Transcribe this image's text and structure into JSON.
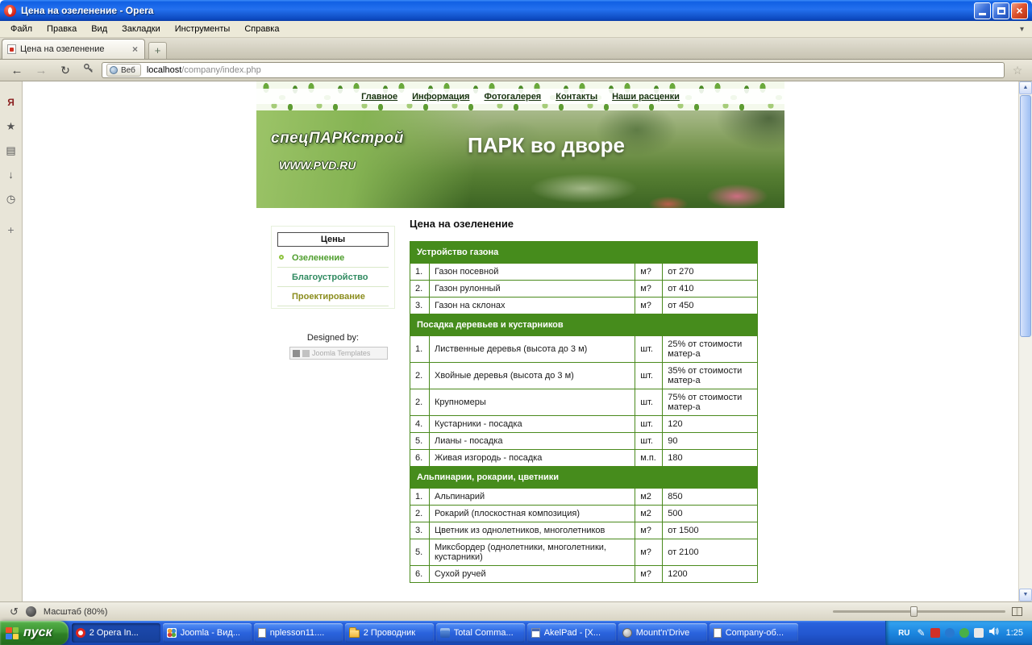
{
  "colors": {
    "accent_green": "#468c1c",
    "xp_blue": "#245edb",
    "start_green": "#3d9434"
  },
  "titlebar": {
    "title": "Цена на озеленение - Opera"
  },
  "menubar": {
    "items": [
      "Файл",
      "Правка",
      "Вид",
      "Закладки",
      "Инструменты",
      "Справка"
    ]
  },
  "tabbar": {
    "active_tab": "Цена на озеленение"
  },
  "addressbar": {
    "badge": "Веб",
    "host": "localhost",
    "path": "/company/index.php"
  },
  "page": {
    "nav_links": [
      "Главное",
      "Информация",
      "Фотогалерея",
      "Контакты",
      "Наши расценки"
    ],
    "banner": {
      "logo_line1": "спецПАРКстрой",
      "logo_line2": "WWW.PVD.RU",
      "slogan": "ПАРК во дворе"
    },
    "menu": {
      "title": "Цены",
      "items": [
        "Озеленение",
        "Благоустройство",
        "Проектирование"
      ]
    },
    "designed_by": "Designed by:",
    "designer_badge": "Joomla Templates",
    "heading": "Цена на озеленение",
    "sections": [
      {
        "header": "Устройство газона",
        "rows": [
          {
            "n": "1.",
            "name": "Газон посевной",
            "unit": "м?",
            "price": "от 270"
          },
          {
            "n": "2.",
            "name": "Газон рулонный",
            "unit": "м?",
            "price": "от 410"
          },
          {
            "n": "3.",
            "name": "Газон на склонах",
            "unit": "м?",
            "price": "от 450"
          }
        ]
      },
      {
        "header": "Посадка деревьев и кустарников",
        "rows": [
          {
            "n": "1.",
            "name": "Лиственные деревья (высота до 3 м)",
            "unit": "шт.",
            "price": "25% от стоимости матер-а"
          },
          {
            "n": "2.",
            "name": "Хвойные деревья (высота до 3 м)",
            "unit": "шт.",
            "price": "35% от стоимости матер-а"
          },
          {
            "n": "2.",
            "name": "Крупномеры",
            "unit": "шт.",
            "price": "75% от стоимости матер-а"
          },
          {
            "n": "4.",
            "name": "Кустарники - посадка",
            "unit": "шт.",
            "price": "120"
          },
          {
            "n": "5.",
            "name": "Лианы - посадка",
            "unit": "шт.",
            "price": "90"
          },
          {
            "n": "6.",
            "name": "Живая изгородь - посадка",
            "unit": "м.п.",
            "price": "180"
          }
        ]
      },
      {
        "header": "Альпинарии, рокарии, цветники",
        "rows": [
          {
            "n": "1.",
            "name": "Альпинарий",
            "unit": "м2",
            "price": "850"
          },
          {
            "n": "2.",
            "name": "Рокарий (плоскостная композиция)",
            "unit": "м2",
            "price": "500"
          },
          {
            "n": "3.",
            "name": "Цветник из однолетников, многолетников",
            "unit": "м?",
            "price": "от 1500"
          },
          {
            "n": "5.",
            "name": "Миксбордер (однолетники, многолетники, кустарники)",
            "unit": "м?",
            "price": "от 2100"
          },
          {
            "n": "6.",
            "name": "Сухой ручей",
            "unit": "м?",
            "price": "1200"
          }
        ]
      }
    ]
  },
  "statusbar": {
    "zoom_label": "Масштаб (80%)"
  },
  "taskbar": {
    "start_label": "пуск",
    "items": [
      {
        "label": "2 Opera In...",
        "icon": "opera"
      },
      {
        "label": "Joomla - Вид...",
        "icon": "joomla"
      },
      {
        "label": "nplesson11....",
        "icon": "document"
      },
      {
        "label": "2 Проводник",
        "icon": "folder"
      },
      {
        "label": "Total Comma...",
        "icon": "total-commander"
      },
      {
        "label": "AkelPad - [X...",
        "icon": "notepad"
      },
      {
        "label": "Mount'n'Drive",
        "icon": "drive"
      },
      {
        "label": "Company-об...",
        "icon": "document"
      }
    ],
    "tray": {
      "lang": "RU",
      "time": "1:25"
    }
  },
  "icons": {
    "back": "←",
    "forward": "→",
    "reload": "↻",
    "close_x": "×",
    "new_tab": "+",
    "chevron_down": "▾",
    "bookmark_star": "☆",
    "panel_star": "★",
    "panel_yandex": "Я",
    "panel_notes": "▤",
    "panel_download": "↓",
    "panel_history": "◷",
    "panel_add": "+",
    "status_undo": "↺",
    "pencil": "✎",
    "scroll_up": "▲",
    "scroll_down": "▼"
  }
}
